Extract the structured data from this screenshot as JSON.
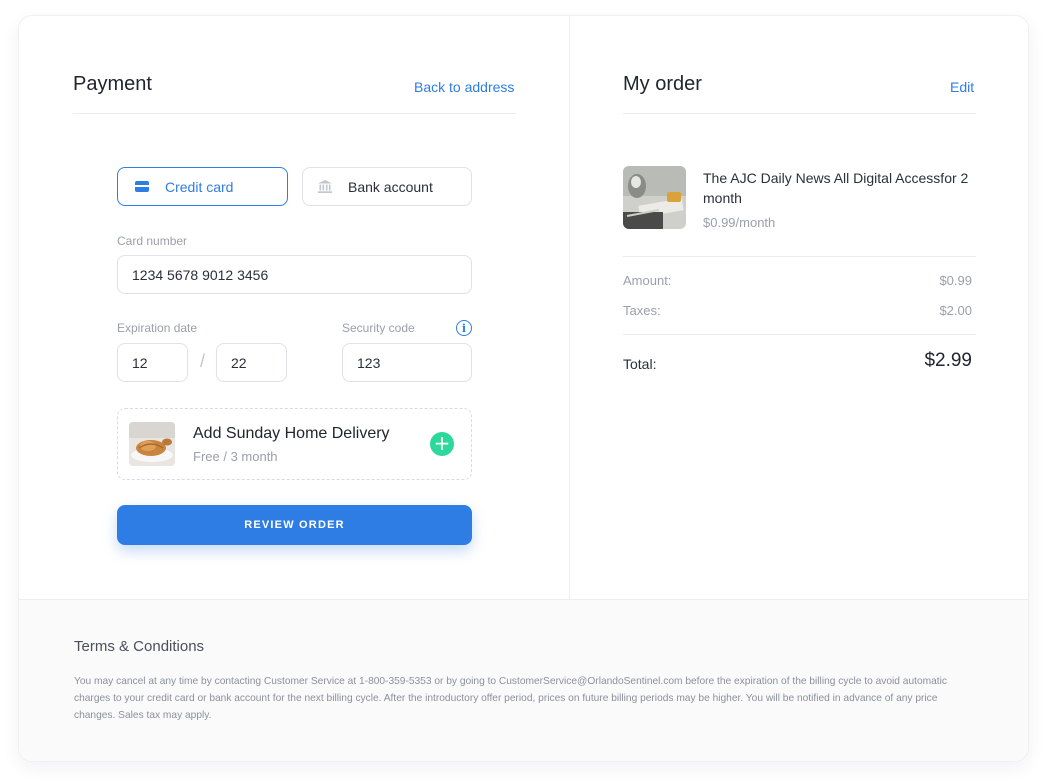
{
  "payment": {
    "title": "Payment",
    "back_link": "Back to address",
    "tabs": {
      "credit_card": "Credit card",
      "bank_account": "Bank account",
      "credit_icon": "credit-card-icon",
      "bank_icon": "bank-icon"
    },
    "card_number_label": "Card number",
    "card_number_value": "1234 5678 9012 3456",
    "expiration_label": "Expiration date",
    "exp_month": "12",
    "exp_separator": "/",
    "exp_year": "22",
    "security_label": "Security code",
    "security_value": "123",
    "info_icon": "i",
    "delivery": {
      "title": "Add Sunday Home Delivery",
      "subtitle": "Free / 3 month",
      "add_icon": "+"
    },
    "review_button": "REVIEW ORDER"
  },
  "order": {
    "title": "My order",
    "edit_link": "Edit",
    "product_name": "The AJC Daily News All Digital Accessfor 2 month",
    "product_price": "$0.99/month",
    "amount_label": "Amount:",
    "amount_value": "$0.99",
    "taxes_label": "Taxes:",
    "taxes_value": "$2.00",
    "total_label": "Total:",
    "total_value": "$2.99"
  },
  "terms": {
    "title": "Terms & Conditions",
    "body": "You may cancel at any time by contacting Customer Service at 1-800-359-5353 or by going to CustomerService@OrlandoSentinel.com before the expiration of the billing cycle to avoid automatic charges to your credit card or bank account for the next billing cycle. After the introductory offer period, prices on future billing periods may be higher. You will be notified in advance of any price changes. Sales tax may apply."
  },
  "colors": {
    "accent": "#2e7de4",
    "add_green": "#2cd89b",
    "muted_text": "#9aa0aa"
  }
}
